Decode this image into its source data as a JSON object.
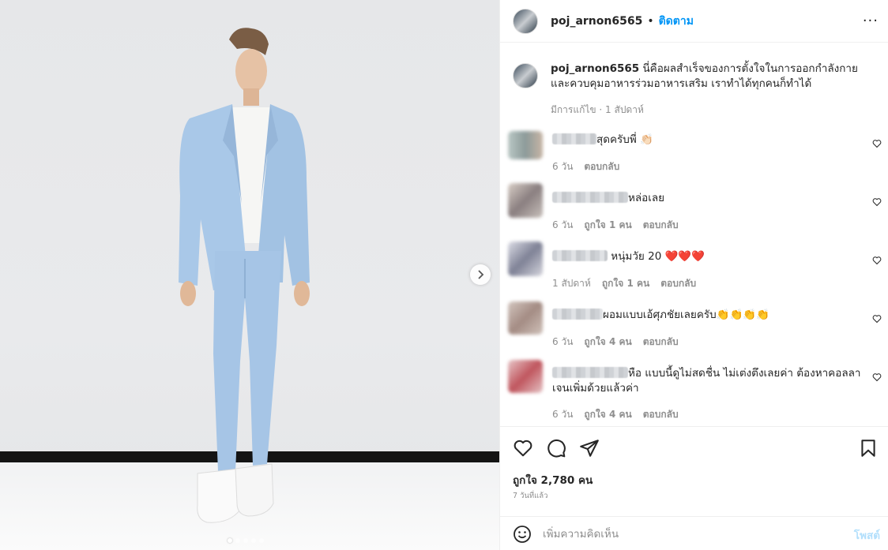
{
  "post": {
    "username": "poj_arnon6565",
    "separator": "•",
    "follow_label": "ติดตาม",
    "more_label": "···"
  },
  "caption": {
    "username": "poj_arnon6565",
    "text": "นี่คือผลสำเร็จของการตั้งใจในการออกกำลังกายและควบคุมอาหารร่วมอาหารเสริม เราทำได้ทุกคนก็ทำได้",
    "meta": "มีการแก้ไข · 1 สัปดาห์"
  },
  "comments": [
    {
      "text": "สุดครับพี่ 👏🏻",
      "time": "6 วัน",
      "likes": "",
      "reply": "ตอบกลับ"
    },
    {
      "text": "หล่อเลย",
      "time": "6 วัน",
      "likes": "ถูกใจ 1 คน",
      "reply": "ตอบกลับ"
    },
    {
      "text": " หนุ่มวัย 20 ❤️❤️❤️",
      "time": "1 สัปดาห์",
      "likes": "ถูกใจ 1 คน",
      "reply": "ตอบกลับ"
    },
    {
      "text": "ผอมแบบเอ้ศุภชัยเลยครับ👏👏👏👏",
      "time": "6 วัน",
      "likes": "ถูกใจ 4 คน",
      "reply": "ตอบกลับ"
    },
    {
      "text": "หือ แบบนี้ดูไม่สดชื่น ไม่เต่งตึงเลยค่า ต้องหาคอลลาเจนเพิ่มด้วยแล้วค่า",
      "time": "6 วัน",
      "likes": "ถูกใจ 4 คน",
      "reply": "ตอบกลับ"
    }
  ],
  "actions": {
    "likes_text": "ถูกใจ 2,780 คน",
    "post_date": "7 วันที่แล้ว"
  },
  "composer": {
    "placeholder": "เพิ่มความคิดเห็น",
    "post_label": "โพสต์"
  },
  "carousel": {
    "slide_count": 5,
    "active_slide": 1
  },
  "colors": {
    "accent": "#0095f6",
    "muted": "#8e8e8e",
    "heart": "#ed4956",
    "suit": "#a9c8e8"
  },
  "icons": [
    "heart-icon",
    "comment-icon",
    "share-icon",
    "bookmark-icon",
    "emoji-icon",
    "more-icon",
    "chevron-right-icon"
  ]
}
